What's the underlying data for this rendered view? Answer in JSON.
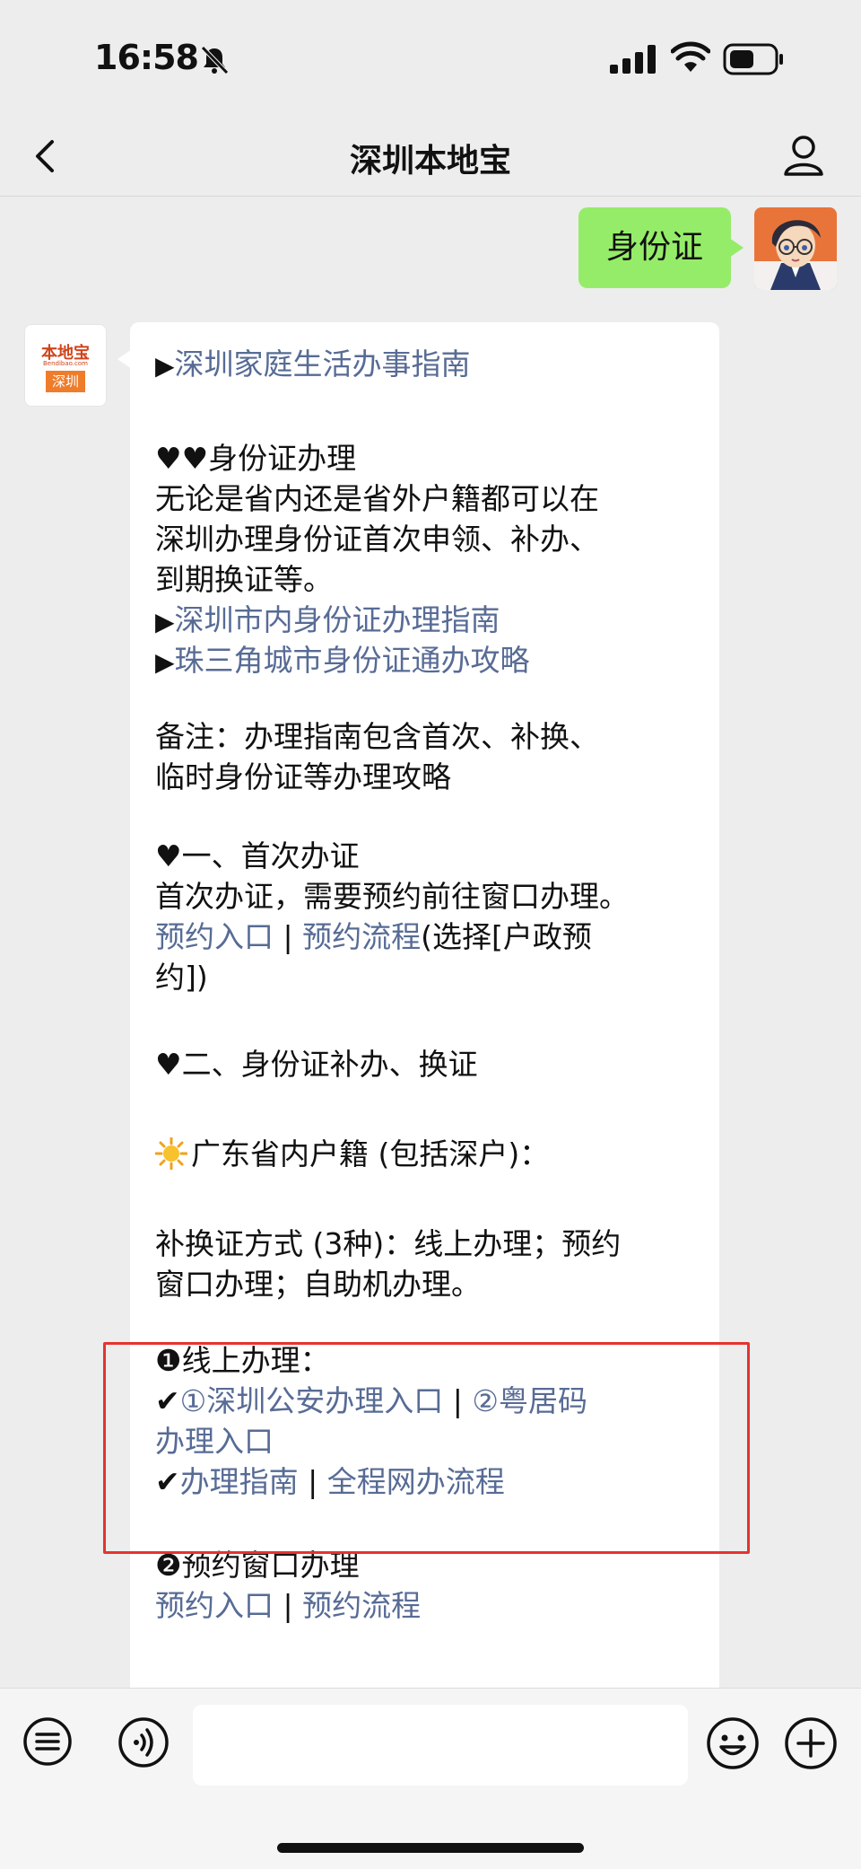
{
  "status_bar": {
    "time": "16:58",
    "icons": [
      "bell-muted-icon",
      "signal-icon",
      "wifi-icon",
      "battery-icon"
    ]
  },
  "nav": {
    "title": "深圳本地宝",
    "back_icon": "chevron-left-icon",
    "profile_icon": "person-icon"
  },
  "chat": {
    "sent_message": "身份证",
    "bot_avatar": {
      "logo_top": "本地宝",
      "logo_mid": "Bendibao.com",
      "logo_box": "深圳"
    },
    "message": {
      "links": {
        "family_guide": "深圳家庭生活办事指南",
        "city_guide": "深圳市内身份证办理指南",
        "prd_guide": "珠三角城市身份证通办攻略",
        "appt_entry_1": "预约入口",
        "appt_flow_1": "预约流程",
        "sz_police": "①深圳公安办理入口",
        "yue_code_a": "②粤居码",
        "yue_code_b": "办理入口",
        "handling_guide": "办理指南",
        "online_flow": "全程网办流程",
        "appt_entry_2": "预约入口",
        "appt_flow_2": "预约流程"
      },
      "text": {
        "tri": "▶",
        "hearts_title": "♥♥身份证办理",
        "intro_1": "无论是省内还是省外户籍都可以在",
        "intro_2": "深圳办理身份证首次申领、补办、",
        "intro_3": "到期换证等。",
        "note_1": "备注：办理指南包含首次、补换、",
        "note_2": "临时身份证等办理攻略",
        "sec1_title": "♥一、首次办证",
        "sec1_body": "首次办证，需要预约前往窗口办理。",
        "sep": " | ",
        "choose_a": "(选择[户政预",
        "choose_b": "约])",
        "sec2_title": "♥二、身份证补办、换证",
        "gd_title": "广东省内户籍 (包括深户)：",
        "methods_1": "补换证方式 (3种)：线上办理；预约",
        "methods_2": "窗口办理；自助机办理。",
        "online_title": "❶线上办理：",
        "check": "✔",
        "window_title": "❷预约窗口办理"
      }
    }
  },
  "input_bar": {
    "keyboard_icon": "keyboard-menu-icon",
    "voice_icon": "voice-icon",
    "input_value": "",
    "emoji_icon": "emoji-icon",
    "plus_icon": "plus-icon"
  }
}
